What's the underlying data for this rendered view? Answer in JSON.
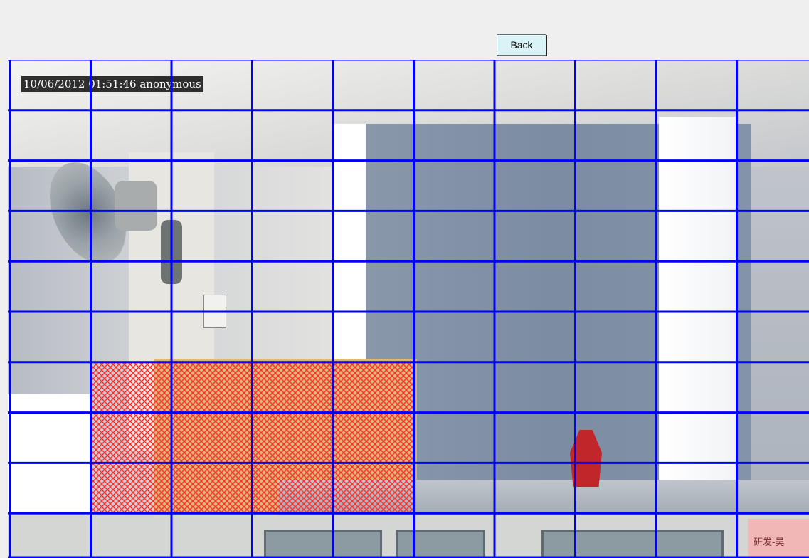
{
  "toolbar": {
    "back_label": "Back"
  },
  "video": {
    "osd_text": "10/06/2012 01:51:46 anonymous",
    "corner_tag": "研发-吴",
    "grid": {
      "columns": 10,
      "rows": 10,
      "line_color": "#0000ff",
      "selected_color": "#ff3030",
      "selected_cells": [
        [
          6,
          1
        ],
        [
          6,
          2
        ],
        [
          6,
          3
        ],
        [
          6,
          4
        ],
        [
          7,
          1
        ],
        [
          7,
          2
        ],
        [
          7,
          3
        ],
        [
          7,
          4
        ],
        [
          8,
          1
        ],
        [
          8,
          2
        ],
        [
          8,
          3
        ],
        [
          8,
          4
        ]
      ]
    }
  }
}
